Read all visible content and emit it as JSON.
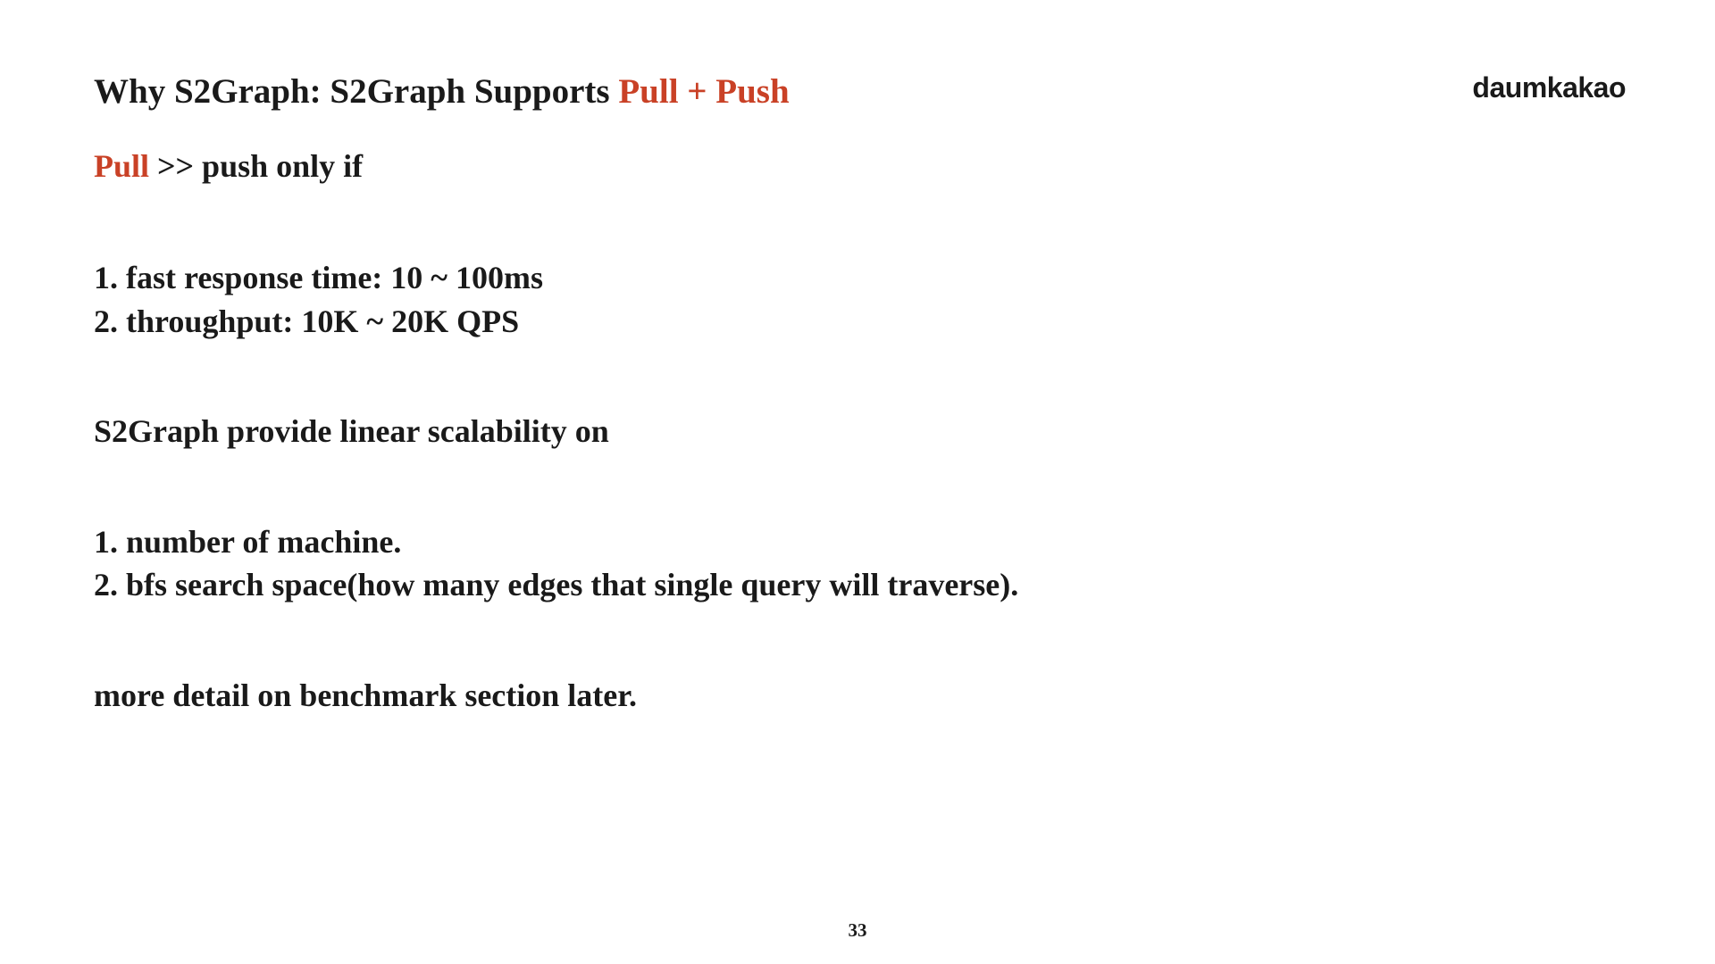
{
  "brand": "daumkakao",
  "title": {
    "plain": "Why S2Graph: S2Graph Supports ",
    "accent": "Pull + Push"
  },
  "subtitle": {
    "accent": "Pull",
    "plain": " >> push only if"
  },
  "block1": {
    "item1": "1. fast response time: 10 ~ 100ms",
    "item2": "2. throughput: 10K ~ 20K QPS"
  },
  "block2": {
    "heading": "S2Graph provide linear scalability on",
    "item1": "1. number of machine.",
    "item2": "2. bfs search space(how many edges that single query will traverse)."
  },
  "footer_note": "more detail on benchmark section later.",
  "page_number": "33"
}
